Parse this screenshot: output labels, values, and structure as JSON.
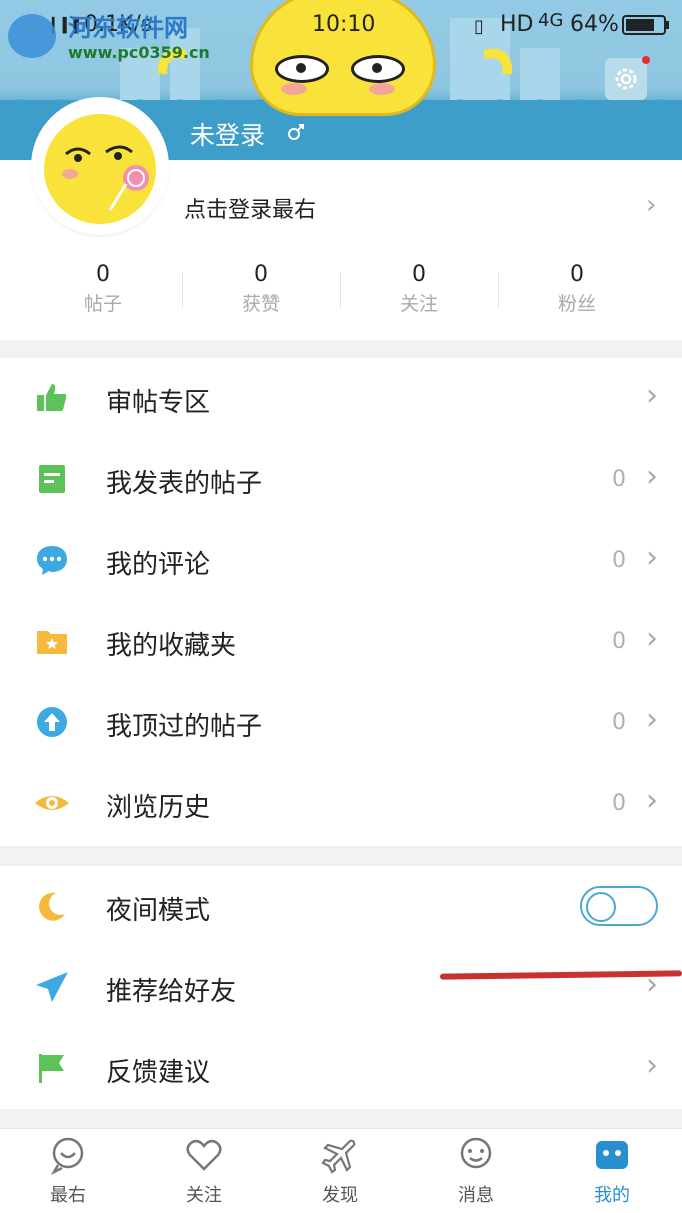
{
  "status_bar": {
    "network_speed": "0.1K/s",
    "time": "10:10",
    "hd": "HD",
    "signal": "4G",
    "battery": "64%"
  },
  "watermark": {
    "line1": "河东软件网",
    "line2": "www.pc0359.cn"
  },
  "profile": {
    "username": "未登录",
    "login_prompt": "点击登录最右",
    "stats": [
      {
        "value": "0",
        "label": "帖子"
      },
      {
        "value": "0",
        "label": "获赞"
      },
      {
        "value": "0",
        "label": "关注"
      },
      {
        "value": "0",
        "label": "粉丝"
      }
    ]
  },
  "menu": [
    {
      "label": "审帖专区",
      "count": "",
      "icon": "thumbs-up-icon",
      "color": "#5bc35a"
    },
    {
      "label": "我发表的帖子",
      "count": "0",
      "icon": "post-icon",
      "color": "#5bc35a"
    },
    {
      "label": "我的评论",
      "count": "0",
      "icon": "comment-icon",
      "color": "#3ea8e0"
    },
    {
      "label": "我的收藏夹",
      "count": "0",
      "icon": "folder-star-icon",
      "color": "#f6b93b"
    },
    {
      "label": "我顶过的帖子",
      "count": "0",
      "icon": "upvote-icon",
      "color": "#3ea8e0"
    },
    {
      "label": "浏览历史",
      "count": "0",
      "icon": "eye-icon",
      "color": "#f6b93b"
    }
  ],
  "settings": [
    {
      "label": "夜间模式",
      "icon": "moon-icon",
      "color": "#f6b93b",
      "toggle": false
    },
    {
      "label": "推荐给好友",
      "icon": "share-icon",
      "color": "#3ea8e0"
    },
    {
      "label": "反馈建议",
      "icon": "flag-icon",
      "color": "#5bc35a"
    }
  ],
  "tabbar": [
    {
      "label": "最右",
      "icon": "zuiyou-icon",
      "active": false
    },
    {
      "label": "关注",
      "icon": "heart-icon",
      "active": false
    },
    {
      "label": "发现",
      "icon": "plane-icon",
      "active": false
    },
    {
      "label": "消息",
      "icon": "message-icon",
      "active": false
    },
    {
      "label": "我的",
      "icon": "profile-icon",
      "active": true
    }
  ]
}
